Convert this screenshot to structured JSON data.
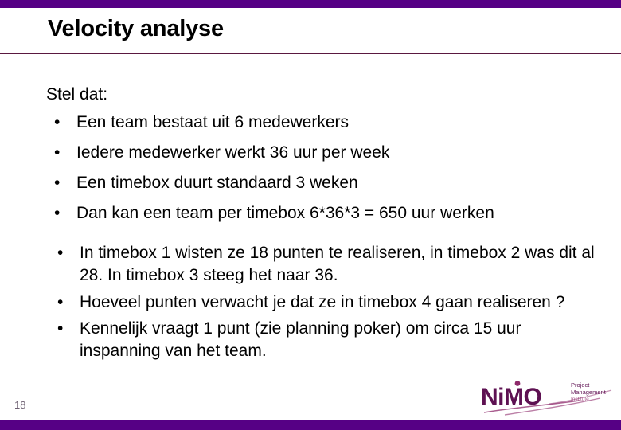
{
  "slide": {
    "title": "Velocity analyse",
    "page_number": "18",
    "lead": "Stel dat:",
    "bullets_group_1": [
      "Een team bestaat uit 6 medewerkers",
      "Iedere medewerker werkt 36 uur per week",
      "Een timebox duurt standaard 3 weken",
      "Dan kan een team per timebox 6*36*3 = 650 uur werken"
    ],
    "bullets_group_2": [
      "In timebox 1 wisten ze 18 punten te realiseren, in timebox 2 was dit al 28. In timebox 3 steeg het naar 36.",
      "Hoeveel punten verwacht je dat ze in timebox 4 gaan realiseren ?",
      "Kennelijk vraagt 1 punt (zie planning poker) om circa 15 uur inspanning van het team."
    ],
    "bullet_glyph": "•"
  },
  "logo": {
    "wordmark": "NiMO",
    "tagline_line_1": "Project",
    "tagline_line_2": "Management",
    "tagline_line_3": "Institute"
  },
  "colors": {
    "band_purple": "#560085",
    "rule_purple": "#5a1840",
    "logo_purple": "#5e1152",
    "logo_magenta": "#8e2a6b",
    "page_number_gray": "#6e6172",
    "text_black": "#000000",
    "background": "#ffffff"
  }
}
